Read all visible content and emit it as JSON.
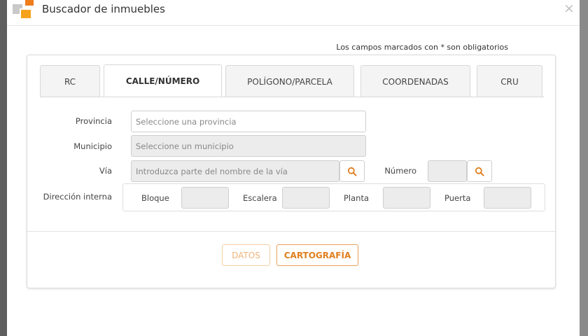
{
  "modal": {
    "title": "Buscador de inmuebles",
    "close_symbol": "×",
    "required_note": "Los campos marcados con * son obligatorios"
  },
  "tabs": [
    {
      "label": "RC",
      "active": false
    },
    {
      "label": "CALLE/NÚMERO",
      "active": true
    },
    {
      "label": "POLÍGONO/PARCELA",
      "active": false
    },
    {
      "label": "COORDENADAS",
      "active": false
    },
    {
      "label": "CRU",
      "active": false
    }
  ],
  "form": {
    "provincia": {
      "label": "Provincia",
      "placeholder": "Seleccione una provincia"
    },
    "municipio": {
      "label": "Municipio",
      "placeholder": "Seleccione un municipio"
    },
    "via": {
      "label": "Vía",
      "placeholder": "Introduzca parte del nombre de la vía"
    },
    "numero": {
      "label": "Número",
      "value": ""
    },
    "direccion_interna": {
      "label": "Dirección interna",
      "bloque": "Bloque",
      "escalera": "Escalera",
      "planta": "Planta",
      "puerta": "Puerta"
    }
  },
  "buttons": {
    "datos": "DATOS",
    "cartografia": "CARTOGRAFÍA"
  },
  "colors": {
    "accent": "#e07f1e",
    "accent_light": "#f0b57a",
    "disabled_bg": "#ececec"
  }
}
